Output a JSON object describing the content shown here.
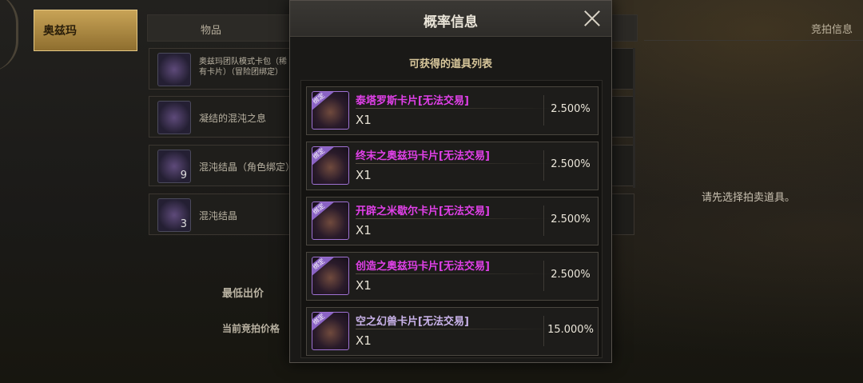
{
  "category_tab": "奥兹玛",
  "header": {
    "item_col": "物品",
    "right_title": "竞拍信息"
  },
  "items": [
    {
      "name": "奥兹玛团队模式卡包（稀有卡片）（冒险团绑定）",
      "extra": "",
      "count": ""
    },
    {
      "name": "凝结的混沌之息",
      "extra": "",
      "count": ""
    },
    {
      "name": "混沌结晶（角色绑定）",
      "extra": "",
      "count": "9"
    },
    {
      "name": "混沌结晶",
      "extra": "",
      "count": "3"
    }
  ],
  "labels": {
    "min_bid": "最低出价",
    "current_bid": "当前竞拍价格"
  },
  "right_hint": "请先选择拍卖道具。",
  "modal": {
    "title": "概率信息",
    "subtitle": "可获得的道具列表",
    "tag_label": "绑定",
    "rewards": [
      {
        "name": "泰塔罗斯卡片[无法交易]",
        "qty": "X1",
        "prob": "2.500%"
      },
      {
        "name": "终末之奥兹玛卡片[无法交易]",
        "qty": "X1",
        "prob": "2.500%"
      },
      {
        "name": "开辟之米歇尔卡片[无法交易]",
        "qty": "X1",
        "prob": "2.500%"
      },
      {
        "name": "创造之奥兹玛卡片[无法交易]",
        "qty": "X1",
        "prob": "2.500%"
      },
      {
        "name": "空之幻兽卡片[无法交易]",
        "qty": "X1",
        "prob": "15.000%"
      }
    ]
  },
  "colors": {
    "accent_gold": "#c9a457",
    "item_name_purple": "#e040e8",
    "icon_border": "#9f72d3"
  },
  "icons": {
    "close": "close-icon"
  }
}
